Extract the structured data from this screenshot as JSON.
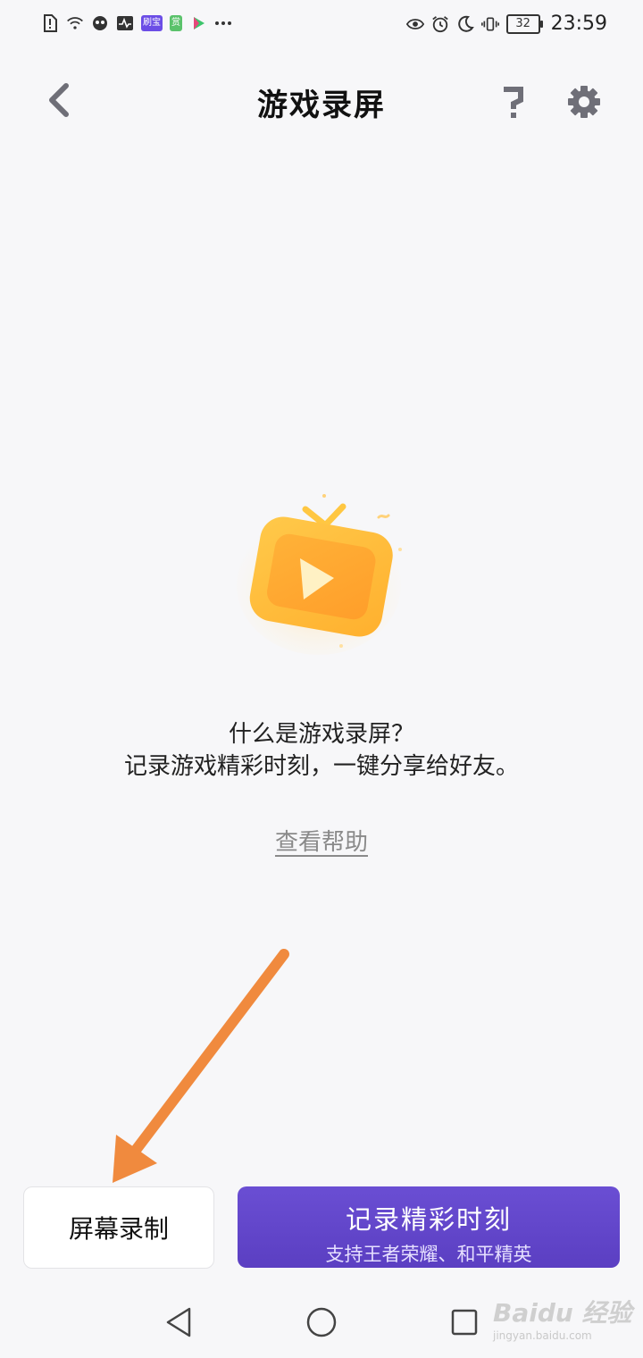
{
  "status_bar": {
    "app_badges": [
      "刷宝",
      "赏"
    ],
    "battery": "32",
    "time": "23:59"
  },
  "header": {
    "title": "游戏录屏"
  },
  "intro": {
    "line1": "什么是游戏录屏？",
    "line2": "记录游戏精彩时刻，一键分享给好友。"
  },
  "help_link": "查看帮助",
  "actions": {
    "screen_record_label": "屏幕录制",
    "highlight_label": "记录精彩时刻",
    "highlight_sub": "支持王者荣耀、和平精英"
  },
  "watermark": {
    "brand": "Baidu 经验",
    "url": "jingyan.baidu.com"
  },
  "colors": {
    "accent": "#5e43c6",
    "annotation_arrow": "#f08a3e",
    "hero_icon": "#ffb938"
  }
}
